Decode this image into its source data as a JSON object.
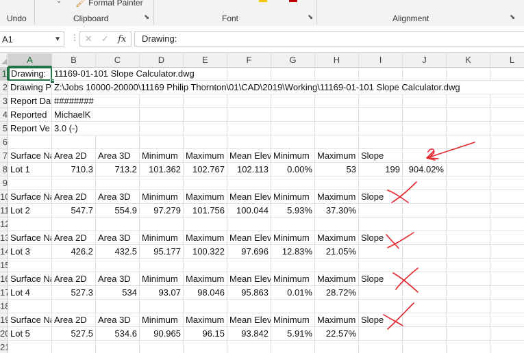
{
  "ribbon": {
    "format_painter": "Format Painter",
    "groups": {
      "undo": "Undo",
      "clipboard": "Clipboard",
      "font": "Font",
      "alignment": "Alignment"
    }
  },
  "formula_bar": {
    "name_box": "A1",
    "formula": "Drawing:"
  },
  "columns": [
    "A",
    "B",
    "C",
    "D",
    "E",
    "F",
    "G",
    "H",
    "I",
    "J",
    "K",
    "L"
  ],
  "rows": [
    {
      "n": "1",
      "cells": [
        "Drawing:",
        "11169-01-101 Slope Calculator.dwg"
      ]
    },
    {
      "n": "2",
      "cells": [
        "Drawing P",
        "Z:\\Jobs 10000-20000\\11169 Philip Thornton\\01\\CAD\\2019\\Working\\11169-01-101 Slope Calculator.dwg"
      ]
    },
    {
      "n": "3",
      "cells": [
        "Report Da",
        "########"
      ]
    },
    {
      "n": "4",
      "cells": [
        "Reported",
        "MichaelK"
      ]
    },
    {
      "n": "5",
      "cells": [
        "Report Ve",
        "3.0 (-)"
      ]
    },
    {
      "n": "6",
      "cells": []
    },
    {
      "n": "7",
      "cells": [
        "Surface Na",
        "Area 2D",
        "Area 3D",
        "Minimum",
        "Maximum",
        "Mean Elev",
        "Minimum",
        "Maximum",
        "Slope"
      ]
    },
    {
      "n": "8",
      "cells": [
        "Lot 1",
        "710.3",
        "713.2",
        "101.362",
        "102.767",
        "102.113",
        "0.00%",
        "53",
        "199",
        "904.02%"
      ]
    },
    {
      "n": "9",
      "cells": []
    },
    {
      "n": "10",
      "cells": [
        "Surface Na",
        "Area 2D",
        "Area 3D",
        "Minimum",
        "Maximum",
        "Mean Elev",
        "Minimum",
        "Maximum",
        "Slope"
      ]
    },
    {
      "n": "11",
      "cells": [
        "Lot 2",
        "547.7",
        "554.9",
        "97.279",
        "101.756",
        "100.044",
        "5.93%",
        "37.30%"
      ]
    },
    {
      "n": "12",
      "cells": []
    },
    {
      "n": "13",
      "cells": [
        "Surface Na",
        "Area 2D",
        "Area 3D",
        "Minimum",
        "Maximum",
        "Mean Elev",
        "Minimum",
        "Maximum",
        "Slope"
      ]
    },
    {
      "n": "14",
      "cells": [
        "Lot 3",
        "426.2",
        "432.5",
        "95.177",
        "100.322",
        "97.696",
        "12.83%",
        "21.05%"
      ]
    },
    {
      "n": "15",
      "cells": []
    },
    {
      "n": "16",
      "cells": [
        "Surface Na",
        "Area 2D",
        "Area 3D",
        "Minimum",
        "Maximum",
        "Mean Elev",
        "Minimum",
        "Maximum",
        "Slope"
      ]
    },
    {
      "n": "17",
      "cells": [
        "Lot 4",
        "527.3",
        "534",
        "93.07",
        "98.046",
        "95.863",
        "0.01%",
        "28.72%"
      ]
    },
    {
      "n": "18",
      "cells": []
    },
    {
      "n": "19",
      "cells": [
        "Surface Na",
        "Area 2D",
        "Area 3D",
        "Minimum",
        "Maximum",
        "Mean Elev",
        "Minimum",
        "Maximum",
        "Slope"
      ]
    },
    {
      "n": "20",
      "cells": [
        "Lot 5",
        "527.5",
        "534.6",
        "90.965",
        "96.15",
        "93.842",
        "5.91%",
        "22.57%"
      ]
    },
    {
      "n": "21",
      "cells": []
    }
  ],
  "annotations": {
    "color": "#e3232a",
    "marks": [
      "arrow-with-2",
      "x-mark",
      "x-mark",
      "x-mark",
      "x-mark"
    ]
  },
  "colors": {
    "accent": "#217346",
    "ink": "#e3232a"
  }
}
